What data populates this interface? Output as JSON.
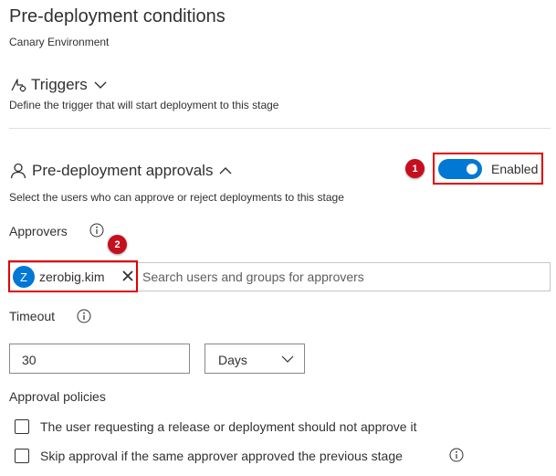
{
  "page": {
    "title": "Pre-deployment conditions",
    "subtitle": "Canary Environment"
  },
  "triggers": {
    "title": "Triggers",
    "description": "Define the trigger that will start deployment to this stage",
    "expanded": false
  },
  "approvals": {
    "title": "Pre-deployment approvals",
    "description": "Select the users who can approve or reject deployments to this stage",
    "expanded": true,
    "toggle_label": "Enabled",
    "toggle_on": true,
    "approvers_label": "Approvers",
    "approvers": [
      {
        "initial": "Z",
        "name": "zerobig.kim"
      }
    ],
    "search_placeholder": "Search users and groups for approvers",
    "timeout_label": "Timeout",
    "timeout_value": "30",
    "timeout_unit": "Days",
    "policies_label": "Approval policies",
    "policies": [
      {
        "label": "The user requesting a release or deployment should not approve it",
        "checked": false
      },
      {
        "label": "Skip approval if the same approver approved the previous stage",
        "checked": false
      }
    ]
  },
  "annotations": {
    "badge_1": "1",
    "badge_2": "2",
    "badge_color": "#c50f1f",
    "highlight_color": "#e00000"
  },
  "colors": {
    "accent": "#0078d4",
    "text": "#323130",
    "placeholder": "#605e5c",
    "divider": "#e1dfdd"
  }
}
